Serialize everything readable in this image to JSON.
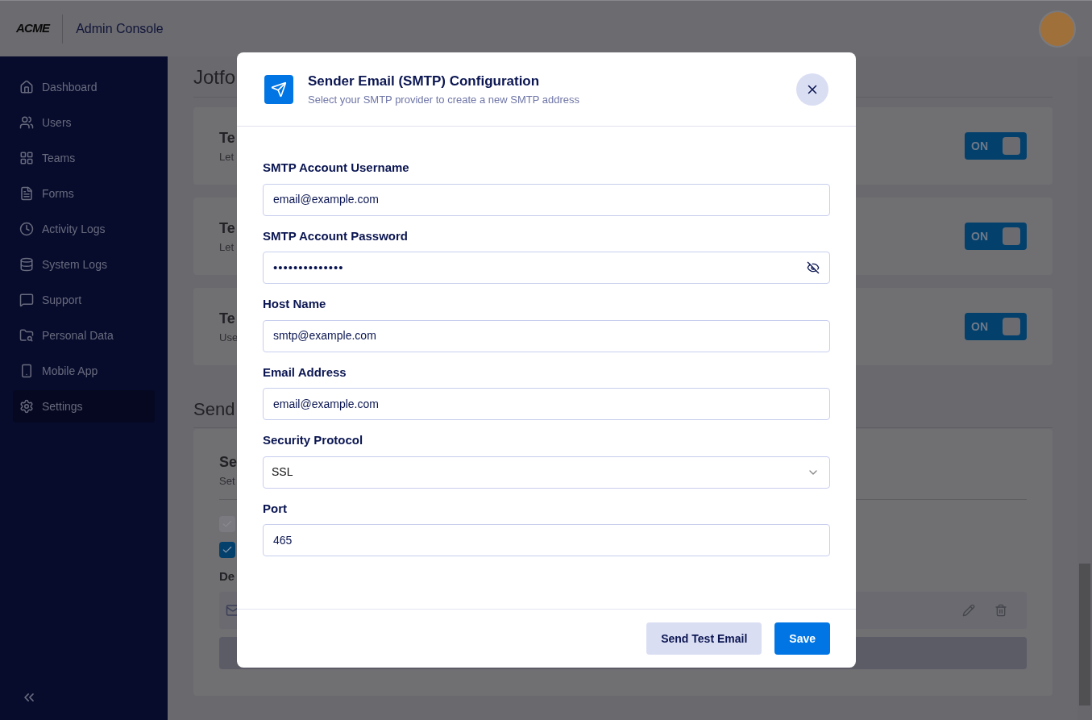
{
  "header": {
    "logo": "ACME",
    "title": "Admin Console"
  },
  "sidebar": {
    "items": [
      {
        "label": "Dashboard",
        "selected": false
      },
      {
        "label": "Users",
        "selected": false
      },
      {
        "label": "Teams",
        "selected": false
      },
      {
        "label": "Forms",
        "selected": false
      },
      {
        "label": "Activity Logs",
        "selected": false
      },
      {
        "label": "System Logs",
        "selected": false
      },
      {
        "label": "Support",
        "selected": false
      },
      {
        "label": "Personal Data",
        "selected": false
      },
      {
        "label": "Mobile App",
        "selected": false
      },
      {
        "label": "Settings",
        "selected": true
      }
    ]
  },
  "content": {
    "section_1": {
      "title": "Jotfo",
      "cards": [
        {
          "title": "Te",
          "description": "Let",
          "toggle": {
            "label": "ON",
            "on": true
          }
        },
        {
          "title": "Te",
          "description": "Let",
          "toggle": {
            "label": "ON",
            "on": true
          }
        },
        {
          "title": "Te",
          "description": "Use",
          "toggle": {
            "label": "ON",
            "on": true
          }
        }
      ]
    },
    "section_2": {
      "title": "Send",
      "card_title": "Se",
      "card_description": "Set",
      "checkboxes": [
        {
          "checked": true,
          "disabled": true
        },
        {
          "checked": true,
          "disabled": false
        }
      ],
      "subtitle": "De"
    }
  },
  "modal": {
    "title": "Sender Email (SMTP) Configuration",
    "subtitle": "Select your SMTP provider to create a new SMTP address",
    "fields": [
      {
        "label": "SMTP Account Username",
        "kind": "text",
        "value": "email@example.com"
      },
      {
        "label": "SMTP Account Password",
        "kind": "password",
        "value": "••••••••••••••"
      },
      {
        "label": "Host Name",
        "kind": "text",
        "value": "smtp@example.com"
      },
      {
        "label": "Email Address",
        "kind": "text",
        "value": "email@example.com"
      },
      {
        "label": "Security Protocol",
        "kind": "select",
        "value": "SSL"
      },
      {
        "label": "Port",
        "kind": "text",
        "value": "465"
      }
    ],
    "buttons": [
      {
        "label": "Send Test Email",
        "kind": "secondary"
      },
      {
        "label": "Save",
        "kind": "primary"
      }
    ]
  }
}
